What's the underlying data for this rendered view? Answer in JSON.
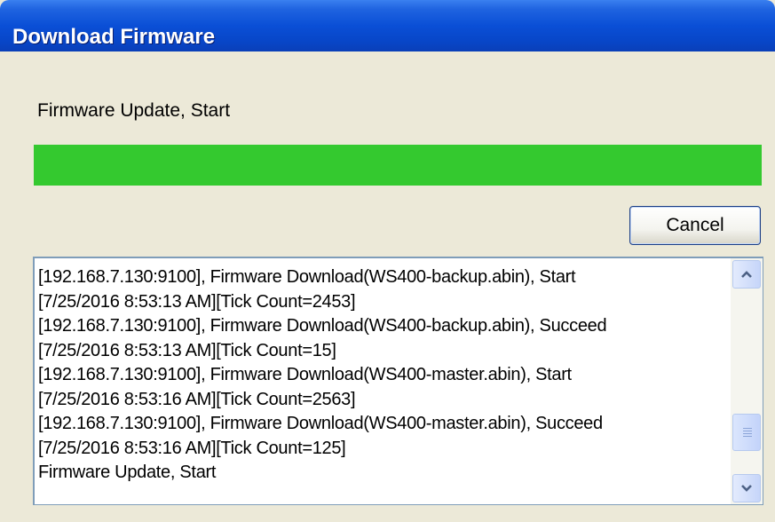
{
  "window": {
    "title": "Download Firmware"
  },
  "status": {
    "label": "Firmware Update, Start"
  },
  "progress": {
    "percent": 100,
    "color": "#34c92f"
  },
  "buttons": {
    "cancel_label": "Cancel"
  },
  "log": {
    "lines": [
      "[192.168.7.130:9100], Firmware Download(WS400-backup.abin), Start",
      "[7/25/2016 8:53:13 AM][Tick Count=2453]",
      "[192.168.7.130:9100], Firmware Download(WS400-backup.abin), Succeed",
      "[7/25/2016 8:53:13 AM][Tick Count=15]",
      "[192.168.7.130:9100], Firmware Download(WS400-master.abin), Start",
      "[7/25/2016 8:53:16 AM][Tick Count=2563]",
      "[192.168.7.130:9100], Firmware Download(WS400-master.abin), Succeed",
      "[7/25/2016 8:53:16 AM][Tick Count=125]",
      "Firmware Update, Start"
    ]
  },
  "scrollbar": {
    "up_icon": "chevron-up-icon",
    "down_icon": "chevron-down-icon",
    "position": 0.85
  },
  "colors": {
    "titlebar": "#0a4fd6",
    "background": "#ece9d8"
  }
}
